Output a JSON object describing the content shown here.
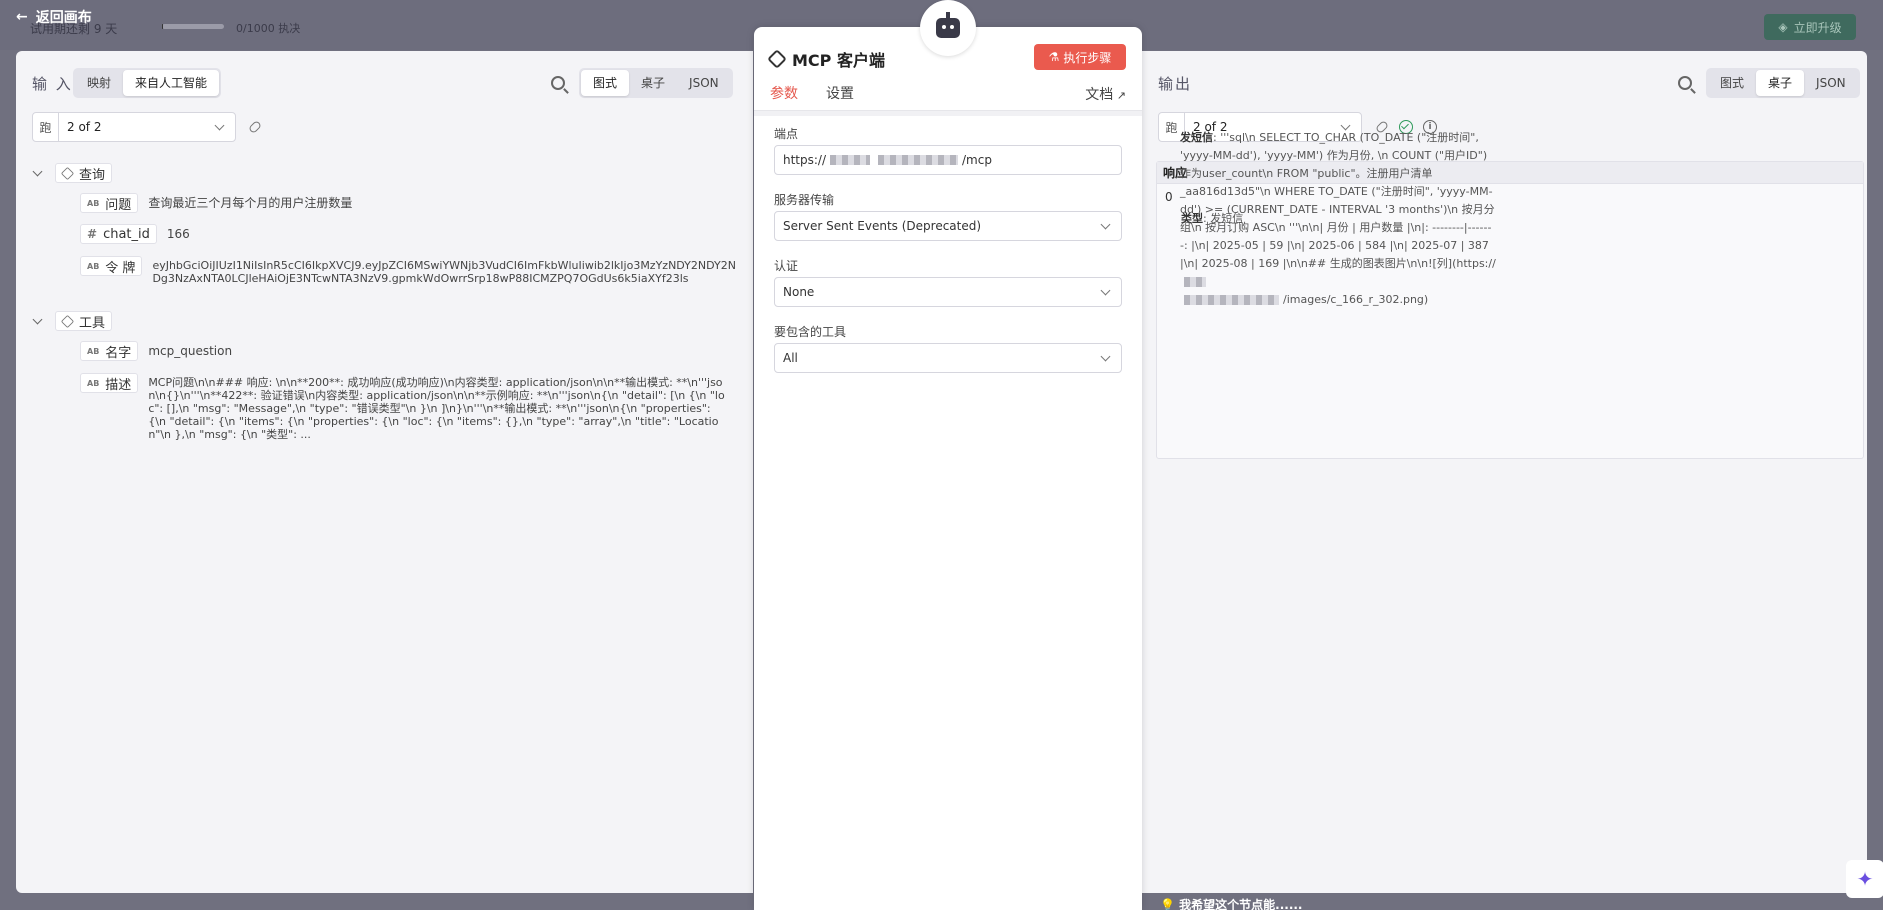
{
  "header": {
    "back_label": "返回画布",
    "trial_text": "试用期还剩 9 天",
    "exec_count": "0/1000 执决",
    "trial_progress_fraction": 0.02,
    "upgrade_label": "立即升级"
  },
  "input": {
    "title": "输 入",
    "mode_tabs": [
      "映射",
      "来自人工智能"
    ],
    "active_mode": "来自人工智能",
    "view_tabs": [
      "图式",
      "桌子",
      "JSON"
    ],
    "active_view": "图式",
    "run_label": "跑",
    "run_value": "2 of 2",
    "groups": [
      {
        "name": "查询",
        "fields": [
          {
            "type": "AB",
            "key": "问题",
            "value": "查询最近三个月每个月的用户注册数量"
          },
          {
            "type": "#",
            "key": "chat_id",
            "value": "166"
          },
          {
            "type": "AB",
            "key": "令 牌",
            "value": "eyJhbGciOiJIUzI1NiIsInR5cCI6IkpXVCJ9.eyJpZCI6MSwiYWNjb3VudCI6ImFkbWluIiwib2lkIjo3MzYzNDY2NDY2NDg3NzAxNTA0LCJleHAiOjE3NTcwNTA3NzV9.gpmkWdOwrrSrp18wP88ICMZPQ7OGdUs6k5iaXYf23ls"
          }
        ]
      },
      {
        "name": "工具",
        "fields": [
          {
            "type": "AB",
            "key": "名字",
            "value": "mcp_question"
          },
          {
            "type": "AB",
            "key": "描述",
            "value": "MCP问题\\n\\n### 响应: \\n\\n**200**: 成功响应(成功响应)\\n内容类型: application/json\\n\\n**输出模式: **\\n'''json\\n{}\\n'''\\n**422**: 验证错误\\n内容类型: application/json\\n\\n**示例响应: **\\n'''json\\n{\\n \"detail\": [\\n {\\n \"loc\": [],\\n \"msg\": \"Message\",\\n \"type\": \"错误类型\"\\n }\\n ]\\n}\\n'''\\n**输出模式: **\\n'''json\\n{\\n \"properties\": {\\n \"detail\": {\\n \"items\": {\\n \"properties\": {\\n \"loc\": {\\n \"items\": {},\\n \"type\": \"array\",\\n \"title\": \"Location\"\\n },\\n \"msg\": {\\n \"类型\": ..."
          }
        ]
      }
    ]
  },
  "node": {
    "title": "MCP 客户端",
    "exec_label": "执行步骤",
    "tabs": [
      "参数",
      "设置"
    ],
    "active_tab": "参数",
    "docs_label": "文档",
    "fields": [
      {
        "label": "端点",
        "value_prefix": "https://",
        "value_suffix": "/mcp"
      },
      {
        "label": "服务器传输",
        "value": "Server Sent Events (Deprecated)"
      },
      {
        "label": "认证",
        "value": "None"
      },
      {
        "label": "要包含的工具",
        "value": "All"
      }
    ]
  },
  "output": {
    "title": "输出",
    "view_tabs": [
      "图式",
      "桌子",
      "JSON"
    ],
    "active_view": "桌子",
    "run_label": "跑",
    "run_value": "2 of 2",
    "response_header": "响应",
    "index": "0",
    "type_key": "类型",
    "type_value": "发短信",
    "text_key": "发短信",
    "text_value": "'''sql\\n SELECT TO_CHAR (TO_DATE (\"注册时间\", 'yyyy-MM-dd'), 'yyyy-MM') 作为月份, \\n COUNT (\"用户ID\") 作为user_count\\n FROM \"public\"。注册用户清单_aa816d13d5\"\\n WHERE TO_DATE (\"注册时间\", 'yyyy-MM-dd') >= (CURRENT_DATE - INTERVAL '3 months')\\n 按月分组\\n 按月订购 ASC\\n '''\\n\\n| 月份 | 用户数量 |\\n|: --------|-------: |\\n| 2025-05 | 59 |\\n| 2025-06 | 584 |\\n| 2025-07 | 387 |\\n| 2025-08 | 169 |\\n\\n## 生成的图表图片\\n\\n![列](https://",
    "text_tail": "/images/c_166_r_302.png)"
  },
  "footer": {
    "feedback_label": "我希望这个节点能......"
  },
  "colors": {
    "accent": "#e5584d",
    "success": "#2f9a5b",
    "upgrade_bg": "#3f6a5e"
  }
}
